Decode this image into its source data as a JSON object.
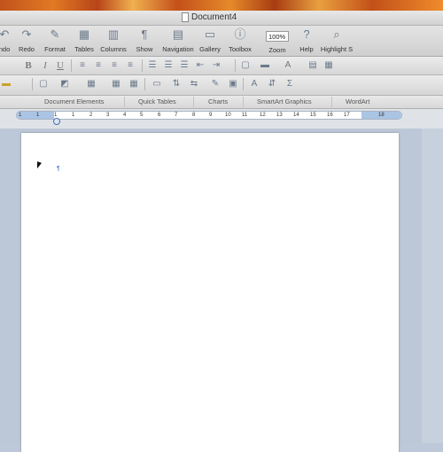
{
  "window": {
    "title": "Document4"
  },
  "toolbar": {
    "undo_label": "ndo",
    "redo_label": "Redo",
    "format_label": "Format",
    "tables_label": "Tables",
    "columns_label": "Columns",
    "show_label": "Show",
    "navigation_label": "Navigation",
    "gallery_label": "Gallery",
    "toolbox_label": "Toolbox",
    "zoom_label": "Zoom",
    "zoom_value": "100%",
    "help_label": "Help",
    "highlight_label": "Highlight S"
  },
  "format_bar": {
    "bold": "B",
    "italic": "I",
    "underline": "U"
  },
  "ribbon": {
    "tabs": [
      "Document Elements",
      "Quick Tables",
      "Charts",
      "SmartArt Graphics",
      "WordArt"
    ]
  },
  "ruler": {
    "labels": [
      "1",
      "1",
      "1",
      "1",
      "2",
      "3",
      "4",
      "5",
      "6",
      "7",
      "8",
      "9",
      "10",
      "11",
      "12",
      "13",
      "14",
      "15",
      "16",
      "17",
      "18"
    ]
  },
  "colors": {
    "page": "#ffffff",
    "canvas": "#bcc7d7",
    "pilcrow": "#4a7cc8"
  }
}
